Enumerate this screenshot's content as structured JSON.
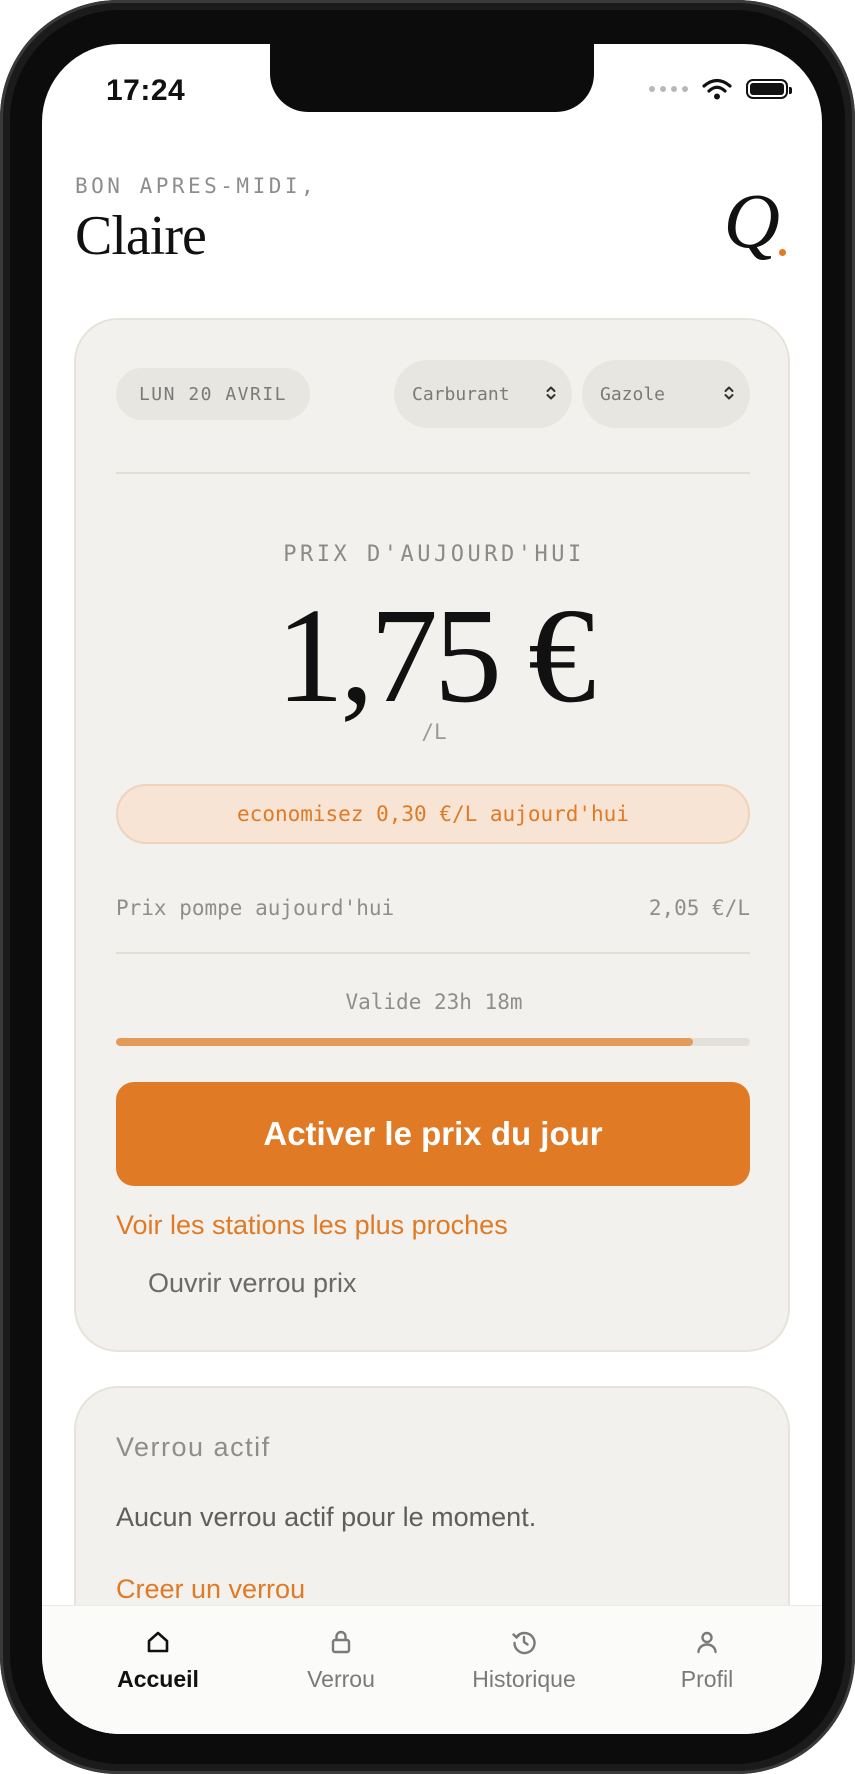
{
  "status_bar": {
    "time": "17:24"
  },
  "header": {
    "greeting": "BON APRES-MIDI,",
    "user_name": "Claire",
    "logo": "Q"
  },
  "controls": {
    "date": "LUN 20 AVRIL",
    "fuel_select": "Carburant",
    "fuel_type_select": "Gazole"
  },
  "price": {
    "label": "PRIX D'AUJOURD'HUI",
    "value": "1,75 €",
    "unit": "/L",
    "savings": "economisez 0,30 €/L aujourd'hui",
    "pump_label": "Prix pompe aujourd'hui",
    "pump_value": "2,05 €/L",
    "validity": "Valide 23h 18m",
    "validity_progress": 0.91
  },
  "actions": {
    "activate": "Activer le prix du jour",
    "nearby_stations": "Voir les stations les plus proches",
    "open_lock": "Ouvrir verrou prix"
  },
  "lock_card": {
    "title": "Verrou actif",
    "empty_text": "Aucun verrou actif pour le moment.",
    "create_link": "Creer un verrou"
  },
  "tabs": [
    {
      "label": "Accueil",
      "icon": "home-icon",
      "active": true
    },
    {
      "label": "Verrou",
      "icon": "lock-icon",
      "active": false
    },
    {
      "label": "Historique",
      "icon": "history-icon",
      "active": false
    },
    {
      "label": "Profil",
      "icon": "profile-icon",
      "active": false
    }
  ],
  "colors": {
    "accent": "#e07a25",
    "card_bg": "#f3f1ed",
    "text": "#111111"
  }
}
